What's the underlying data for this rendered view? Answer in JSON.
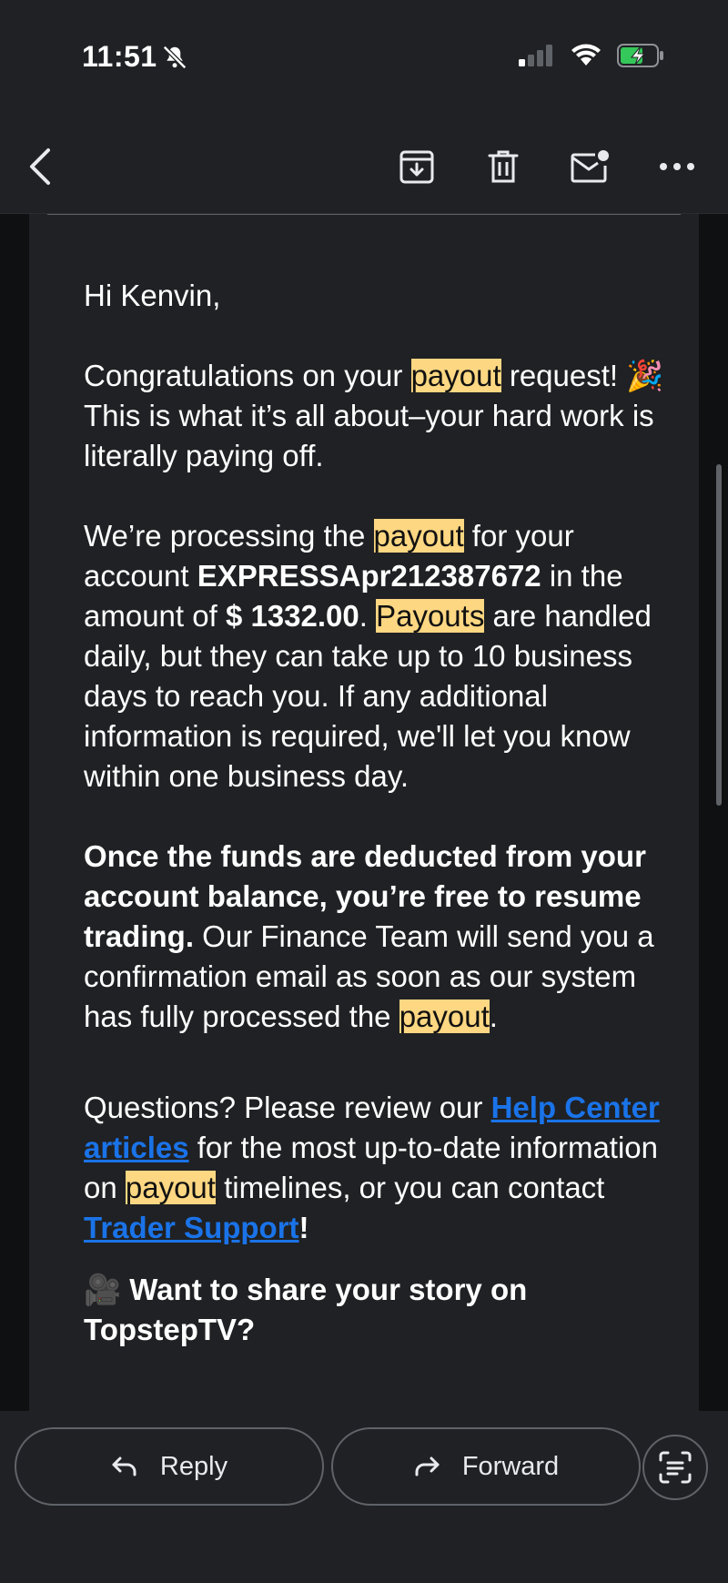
{
  "status_bar": {
    "time": "11:51"
  },
  "email": {
    "greeting": "Hi Kenvin,",
    "p1": {
      "a": "Congratulations on your ",
      "hl1": "payout",
      "b": " request! 🎉 This is what it’s all about–your hard work is literally paying off."
    },
    "p2": {
      "a": "We’re processing the ",
      "hl1": "payout",
      "b": " for your account ",
      "account": "EXPRESSApr212387672",
      "c": " in the amount of ",
      "amount": "$ 1332.00",
      "d": ". ",
      "hl2": "Payouts",
      "e": " are handled daily, but they can take up to 10 business days to reach you. If any additional information is required, we'll let you know within one business day."
    },
    "p3": {
      "bold": "Once the funds are deducted from your account balance, you’re free to resume trading.",
      "a": " Our Finance Team will send you a confirmation email as soon as our system has fully processed the ",
      "hl1": "payout",
      "b": "."
    },
    "p4": {
      "a": "Questions? Please review our ",
      "link1": "Help Center articles",
      "b": " for the most up-to-date information on ",
      "hl1": "payout",
      "c": " timelines, or you can contact ",
      "link2": "Trader Support",
      "d": "!"
    },
    "p5": {
      "emoji": "🎥",
      "heading": " Want to share your story on TopstepTV?"
    }
  },
  "bottom_bar": {
    "reply_label": "Reply",
    "forward_label": "Forward"
  }
}
